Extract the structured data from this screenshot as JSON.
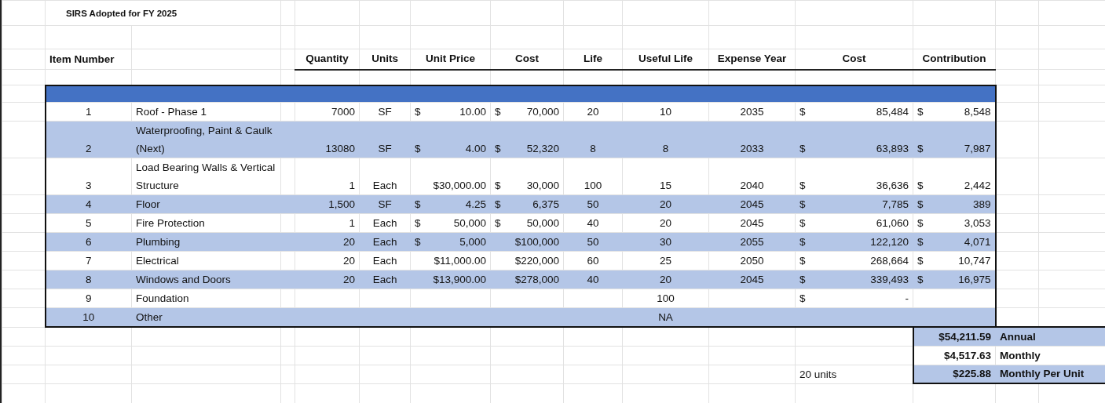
{
  "title": "SIRS Adopted for FY 2025",
  "columns": [
    "Item Number",
    "Quantity",
    "Units",
    "Unit Price",
    "Cost",
    "Life",
    "Useful Life",
    "Expense Year",
    "Cost",
    "Contribution"
  ],
  "rows": [
    {
      "number": "1",
      "description": "Roof - Phase 1",
      "quantity": "7000",
      "units": "SF",
      "unit_price": [
        "$",
        "10.00"
      ],
      "cost": [
        "$",
        "70,000"
      ],
      "life": "20",
      "useful_life": "10",
      "expense_year": "2035",
      "cost_2": [
        "$",
        "85,484"
      ],
      "contribution": [
        "$",
        "8,548"
      ],
      "shaded": false
    },
    {
      "number": "2",
      "description": "Waterproofing, Paint & Caulk (Next)",
      "quantity": "13080",
      "units": "SF",
      "unit_price": [
        "$",
        "4.00"
      ],
      "cost": [
        "$",
        "52,320"
      ],
      "life": "8",
      "useful_life": "8",
      "expense_year": "2033",
      "cost_2": [
        "$",
        "63,893"
      ],
      "contribution": [
        "$",
        "7,987"
      ],
      "shaded": true
    },
    {
      "number": "3",
      "description": "Load Bearing Walls & Vertical Structure",
      "quantity": "1",
      "units": "Each",
      "unit_price": [
        "$30,000.00"
      ],
      "cost": [
        "$",
        "30,000"
      ],
      "life": "100",
      "useful_life": "15",
      "expense_year": "2040",
      "cost_2": [
        "$",
        "36,636"
      ],
      "contribution": [
        "$",
        "2,442"
      ],
      "shaded": false
    },
    {
      "number": "4",
      "description": "Floor",
      "quantity": "1,500",
      "units": "SF",
      "unit_price": [
        "$",
        "4.25"
      ],
      "cost": [
        "$",
        "6,375"
      ],
      "life": "50",
      "useful_life": "20",
      "expense_year": "2045",
      "cost_2": [
        "$",
        "7,785"
      ],
      "contribution": [
        "$",
        "389"
      ],
      "shaded": true
    },
    {
      "number": "5",
      "description": "Fire Protection",
      "quantity": "1",
      "units": "Each",
      "unit_price": [
        "$",
        "50,000"
      ],
      "cost": [
        "$",
        "50,000"
      ],
      "life": "40",
      "useful_life": "20",
      "expense_year": "2045",
      "cost_2": [
        "$",
        "61,060"
      ],
      "contribution": [
        "$",
        "3,053"
      ],
      "shaded": false
    },
    {
      "number": "6",
      "description": "Plumbing",
      "quantity": "20",
      "units": "Each",
      "unit_price": [
        "$",
        "5,000"
      ],
      "cost": [
        "$100,000"
      ],
      "life": "50",
      "useful_life": "30",
      "expense_year": "2055",
      "cost_2": [
        "$",
        "122,120"
      ],
      "contribution": [
        "$",
        "4,071"
      ],
      "shaded": true
    },
    {
      "number": "7",
      "description": "Electrical",
      "quantity": "20",
      "units": "Each",
      "unit_price": [
        "$11,000.00"
      ],
      "cost": [
        "$220,000"
      ],
      "life": "60",
      "useful_life": "25",
      "expense_year": "2050",
      "cost_2": [
        "$",
        "268,664"
      ],
      "contribution": [
        "$",
        "10,747"
      ],
      "shaded": false
    },
    {
      "number": "8",
      "description": "Windows and Doors",
      "quantity": "20",
      "units": "Each",
      "unit_price": [
        "$13,900.00"
      ],
      "cost": [
        "$278,000"
      ],
      "life": "40",
      "useful_life": "20",
      "expense_year": "2045",
      "cost_2": [
        "$",
        "339,493"
      ],
      "contribution": [
        "$",
        "16,975"
      ],
      "shaded": true
    },
    {
      "number": "9",
      "description": "Foundation",
      "useful_life": "100",
      "cost_2": [
        "$",
        "-"
      ],
      "shaded": false
    },
    {
      "number": "10",
      "description": "Other",
      "useful_life": "NA",
      "shaded": true
    }
  ],
  "summary": [
    {
      "amount": "$54,211.59",
      "label": "Annual",
      "shaded": true
    },
    {
      "amount": "$4,517.63",
      "label": "Monthly",
      "shaded": false
    },
    {
      "amount": "$225.88",
      "label": "Monthly Per Unit",
      "shaded": true
    }
  ],
  "units_note": "20 units"
}
